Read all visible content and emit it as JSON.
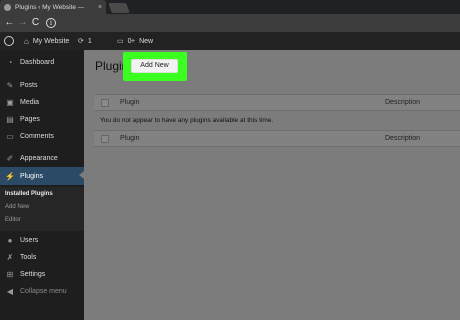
{
  "browser": {
    "tab_title": "Plugins ‹ My Website —",
    "tab_close": "×",
    "back": "←",
    "forward": "→",
    "reload": "C",
    "info": "i"
  },
  "admin_bar": {
    "site_name": "My Website",
    "updates_count": "1",
    "comments_count": "0",
    "new_label": "New"
  },
  "sidebar": {
    "items": [
      {
        "icon": "dashboard-icon",
        "label": "Dashboard"
      },
      {
        "icon": "pin-icon",
        "label": "Posts"
      },
      {
        "icon": "media-icon",
        "label": "Media"
      },
      {
        "icon": "pages-icon",
        "label": "Pages"
      },
      {
        "icon": "comments-icon",
        "label": "Comments"
      },
      {
        "icon": "appearance-icon",
        "label": "Appearance"
      },
      {
        "icon": "plugins-icon",
        "label": "Plugins"
      },
      {
        "icon": "users-icon",
        "label": "Users"
      },
      {
        "icon": "tools-icon",
        "label": "Tools"
      },
      {
        "icon": "settings-icon",
        "label": "Settings"
      },
      {
        "icon": "collapse-icon",
        "label": "Collapse menu"
      }
    ],
    "submenu": [
      "Installed Plugins",
      "Add New",
      "Editor"
    ]
  },
  "main": {
    "title": "Plugins",
    "add_new": "Add New",
    "table": {
      "col_plugin": "Plugin",
      "col_description": "Description",
      "empty_message": "You do not appear to have any plugins available at this time."
    }
  }
}
